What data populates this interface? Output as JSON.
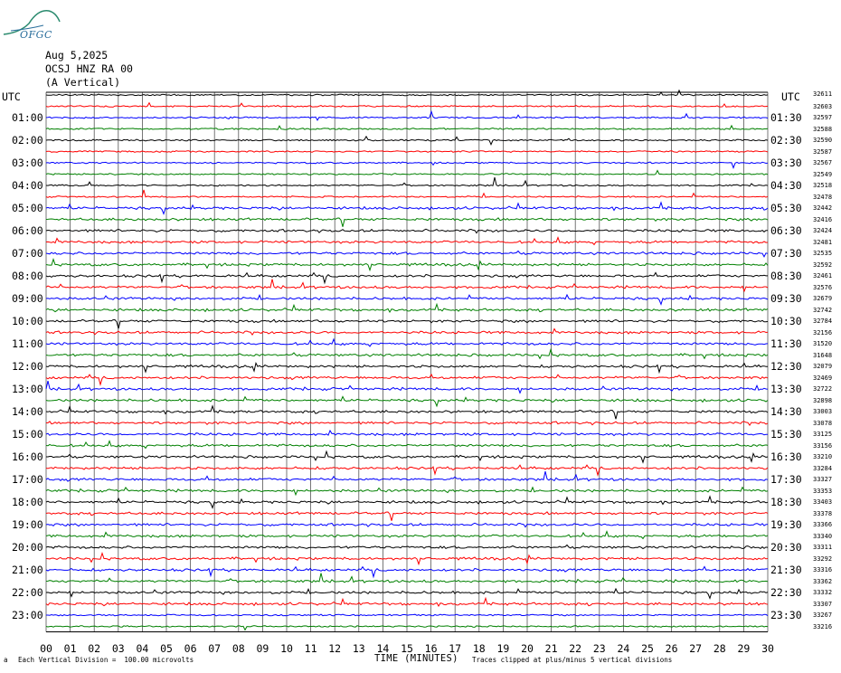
{
  "logo": {
    "text": "OFGC",
    "color": "#2a6e9c"
  },
  "header": {
    "date": "Aug 5,2025",
    "station": "OCSJ HNZ RA 00",
    "component": "(A Vertical)"
  },
  "axis_labels": {
    "left_utc": "UTC",
    "right_utc": "UTC",
    "top_right_count": "32611"
  },
  "chart_data": {
    "type": "line",
    "title": "",
    "xlabel": "TIME (MINUTES)",
    "ylabel": "",
    "xlim": [
      0,
      30
    ],
    "x_ticks": [
      "00",
      "01",
      "02",
      "03",
      "04",
      "05",
      "06",
      "07",
      "08",
      "09",
      "10",
      "11",
      "12",
      "13",
      "14",
      "15",
      "16",
      "17",
      "18",
      "19",
      "20",
      "21",
      "22",
      "23",
      "24",
      "25",
      "26",
      "27",
      "28",
      "29",
      "30"
    ],
    "left_hour_labels": [
      "01:00",
      "02:00",
      "03:00",
      "04:00",
      "05:00",
      "06:00",
      "07:00",
      "08:00",
      "09:00",
      "10:00",
      "11:00",
      "12:00",
      "13:00",
      "14:00",
      "15:00",
      "16:00",
      "17:00",
      "18:00",
      "19:00",
      "20:00",
      "21:00",
      "22:00",
      "23:00"
    ],
    "right_hour_labels": [
      "01:30",
      "02:30",
      "03:30",
      "04:30",
      "05:30",
      "06:30",
      "07:30",
      "08:30",
      "09:30",
      "10:30",
      "11:30",
      "12:30",
      "13:30",
      "14:30",
      "15:30",
      "16:30",
      "17:30",
      "18:30",
      "19:30",
      "20:30",
      "21:30",
      "22:30",
      "23:30"
    ],
    "trace_colors": [
      "#000000",
      "#ff0000",
      "#0000ff",
      "#008000"
    ],
    "trace_counts": [
      "32611",
      "32603",
      "32597",
      "32588",
      "32590",
      "32587",
      "32567",
      "32549",
      "32518",
      "32478",
      "32442",
      "32416",
      "32424",
      "32481",
      "32535",
      "32592",
      "32461",
      "32576",
      "32679",
      "32742",
      "32784",
      "32156",
      "31520",
      "31648",
      "32079",
      "32469",
      "32722",
      "32898",
      "33003",
      "33078",
      "33125",
      "33156",
      "33210",
      "33284",
      "33327",
      "33353",
      "33403",
      "33378",
      "33366",
      "33340",
      "33311",
      "33292",
      "33316",
      "33362",
      "33332",
      "33307",
      "33267",
      "33216"
    ],
    "trace_interval_minutes": 30,
    "grid": true
  },
  "footer": {
    "scale_note": "Each Vertical Division =  100.00 microvolts",
    "clip_note": "Traces clipped at plus/minus 5 vertical divisions"
  }
}
